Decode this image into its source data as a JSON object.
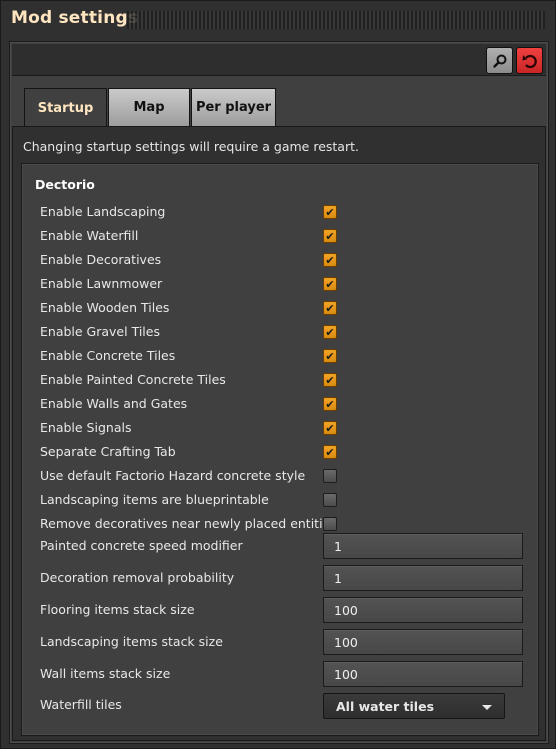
{
  "window": {
    "title": "Mod settings"
  },
  "toolbar": {
    "search_icon": "magnifier-icon",
    "reset_icon": "reset-icon",
    "reset_color": "#e03030"
  },
  "tabs": [
    {
      "label": "Startup",
      "active": true
    },
    {
      "label": "Map",
      "active": false
    },
    {
      "label": "Per player",
      "active": false
    }
  ],
  "panel": {
    "notice": "Changing startup settings will require a game restart.",
    "section": "Dectorio",
    "checkboxes": [
      {
        "label": "Enable Landscaping",
        "checked": true
      },
      {
        "label": "Enable Waterfill",
        "checked": true
      },
      {
        "label": "Enable Decoratives",
        "checked": true
      },
      {
        "label": "Enable Lawnmower",
        "checked": true
      },
      {
        "label": "Enable Wooden Tiles",
        "checked": true
      },
      {
        "label": "Enable Gravel Tiles",
        "checked": true
      },
      {
        "label": "Enable Concrete Tiles",
        "checked": true
      },
      {
        "label": "Enable Painted Concrete Tiles",
        "checked": true
      },
      {
        "label": "Enable Walls and Gates",
        "checked": true
      },
      {
        "label": "Enable Signals",
        "checked": true
      },
      {
        "label": "Separate Crafting Tab",
        "checked": true
      },
      {
        "label": "Use default Factorio Hazard concrete style",
        "checked": false
      },
      {
        "label": "Landscaping items are blueprintable",
        "checked": false
      },
      {
        "label": "Remove decoratives near newly placed entities",
        "checked": false
      }
    ],
    "fields": [
      {
        "label": "Painted concrete speed modifier",
        "value": "1"
      },
      {
        "label": "Decoration removal probability",
        "value": "1"
      },
      {
        "label": "Flooring items stack size",
        "value": "100"
      },
      {
        "label": "Landscaping items stack size",
        "value": "100"
      },
      {
        "label": "Wall items stack size",
        "value": "100"
      }
    ],
    "dropdown": {
      "label": "Waterfill tiles",
      "selected": "All water tiles"
    }
  },
  "colors": {
    "accent_checkbox": "#e8961b",
    "title_text": "#ffe6c0"
  }
}
